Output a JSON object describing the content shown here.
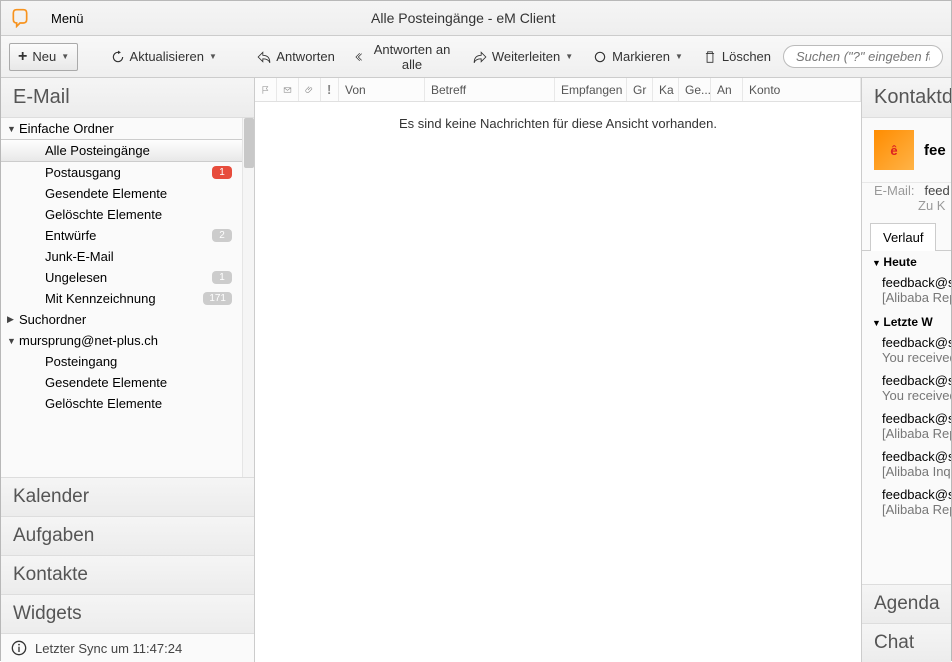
{
  "window": {
    "title": "Alle Posteingänge - eM Client",
    "menu": "Menü"
  },
  "toolbar": {
    "new": "Neu",
    "refresh": "Aktualisieren",
    "reply": "Antworten",
    "reply_all": "Antworten an alle",
    "forward": "Weiterleiten",
    "mark": "Markieren",
    "delete": "Löschen"
  },
  "search": {
    "placeholder": "Suchen (\"?\" eingeben fü"
  },
  "sidebar": {
    "section_mail": "E-Mail",
    "folders_simple": "Einfache Ordner",
    "items": [
      {
        "label": "Alle Posteingänge",
        "selected": true
      },
      {
        "label": "Postausgang",
        "badge": "1",
        "badge_red": true
      },
      {
        "label": "Gesendete Elemente"
      },
      {
        "label": "Gelöschte Elemente"
      },
      {
        "label": "Entwürfe",
        "badge": "2"
      },
      {
        "label": "Junk-E-Mail"
      },
      {
        "label": "Ungelesen",
        "badge": "1"
      },
      {
        "label": "Mit Kennzeichnung",
        "badge": "171"
      }
    ],
    "search_folders": "Suchordner",
    "account": "mursprung@net-plus.ch",
    "account_items": [
      {
        "label": "Posteingang"
      },
      {
        "label": "Gesendete Elemente"
      },
      {
        "label": "Gelöschte Elemente"
      }
    ],
    "nav_calendar": "Kalender",
    "nav_tasks": "Aufgaben",
    "nav_contacts": "Kontakte",
    "nav_widgets": "Widgets",
    "sync": "Letzter Sync um 11:47:24"
  },
  "columns": {
    "from": "Von",
    "subject": "Betreff",
    "received": "Empfangen",
    "size": "Gr",
    "cat": "Ka",
    "read": "Ge...",
    "to": "An",
    "account": "Konto"
  },
  "content": {
    "empty": "Es sind keine Nachrichten für diese Ansicht vorhanden."
  },
  "right": {
    "header": "Kontaktd",
    "name": "fee",
    "email_label": "E-Mail:",
    "email": "feed",
    "email_sub": "Zu K",
    "tab_history": "Verlauf",
    "groups": [
      {
        "title": "Heute",
        "items": [
          {
            "t": "feedback@s",
            "s": "[Alibaba Rep"
          }
        ]
      },
      {
        "title": "Letzte W",
        "items": [
          {
            "t": "feedback@s",
            "s": "You received"
          },
          {
            "t": "feedback@s",
            "s": "You received"
          },
          {
            "t": "feedback@s",
            "s": "[Alibaba Rep"
          },
          {
            "t": "feedback@s",
            "s": "[Alibaba Inq"
          },
          {
            "t": "feedback@s",
            "s": "[Alibaba Rep"
          }
        ]
      }
    ],
    "nav_agenda": "Agenda",
    "nav_chat": "Chat"
  }
}
